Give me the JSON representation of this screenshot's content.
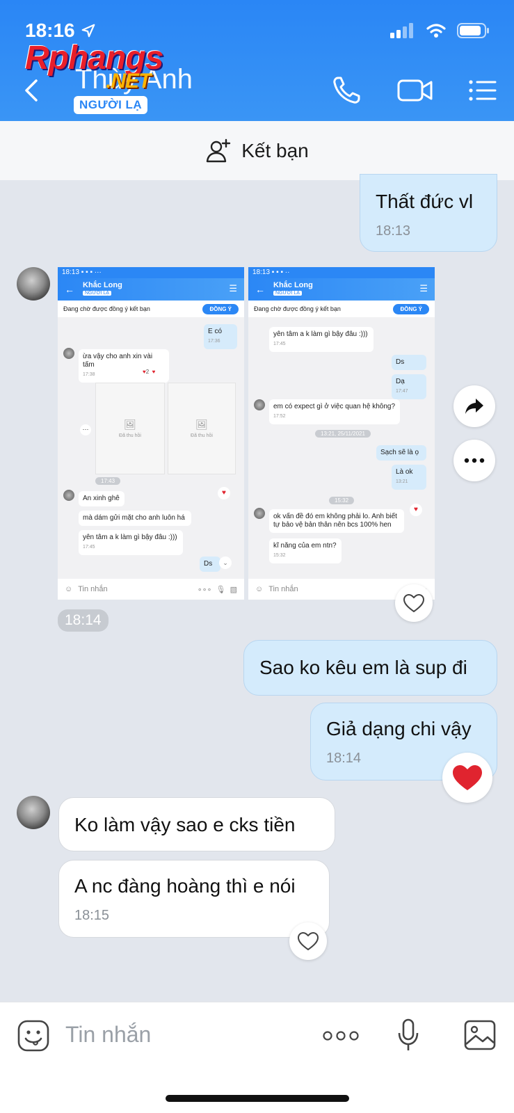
{
  "status": {
    "time": "18:16"
  },
  "watermark": {
    "brand": "Rphangs",
    "suffix": ".NET"
  },
  "header": {
    "contact_name": "Thùy Anh",
    "badge": "NGƯỜI LẠ"
  },
  "friend_bar": {
    "label": "Kết bạn"
  },
  "messages": {
    "m1": {
      "text": "Thất đức vl",
      "time": "18:13"
    },
    "img_time": "18:14",
    "m2": {
      "text": "Sao ko kêu em là sup đi"
    },
    "m3": {
      "text": "Giả dạng chi vậy",
      "time": "18:14"
    },
    "m4": {
      "text": "Ko làm vậy sao e  cks tiền"
    },
    "m5": {
      "text": "A nc đàng hoàng thì e nói",
      "time": "18:15"
    }
  },
  "shot_left": {
    "time": "18:13",
    "name": "Khắc Long",
    "badge": "NGƯỜI LẠ",
    "pending": "Đang chờ được đồng ý kết bạn",
    "accept": "ĐỒNG Ý",
    "msgs": [
      {
        "text": "E có",
        "time": "17:36"
      },
      {
        "text": "ừa vậy cho anh xin vài tấm",
        "time": "17:38"
      },
      {
        "text": "Đã thu hồi"
      },
      {
        "text": "Đã thu hồi"
      },
      {
        "text": "17:43"
      },
      {
        "text": "An xinh ghê"
      },
      {
        "text": "mà dám gửi mặt cho anh luôn há"
      },
      {
        "text": "yên tâm a k làm gì bậy đâu :)))",
        "time": "17:45"
      },
      {
        "text": "Ds"
      }
    ],
    "react_count": "2",
    "input": "Tin nhắn"
  },
  "shot_right": {
    "time": "18:13",
    "name": "Khắc Long",
    "badge": "NGƯỜI LẠ",
    "pending": "Đang chờ được đồng ý kết bạn",
    "accept": "ĐỒNG Ý",
    "msgs": [
      {
        "text": "yên tâm a k làm gì bậy đâu :)))",
        "time": "17:45"
      },
      {
        "text": "Ds"
      },
      {
        "text": "Dạ",
        "time": "17:47"
      },
      {
        "text": "em có expect gì ở việc quan hệ không?",
        "time": "17:52"
      },
      {
        "text": "13:21, 25/11/2021"
      },
      {
        "text": "Sạch sẽ là ọ"
      },
      {
        "text": "Là ok",
        "time": "13:21"
      },
      {
        "text": "15:32"
      },
      {
        "text": "ok vấn đề đó em không phải lo. Anh biết tự bảo vệ bản thân nên bcs 100% hen"
      },
      {
        "text": "kĩ năng của em ntn?",
        "time": "15:32"
      }
    ],
    "input": "Tin nhắn"
  },
  "composer": {
    "placeholder": "Tin nhắn"
  },
  "colors": {
    "header": "#2a86f5",
    "my_bubble": "#d4ebfc",
    "heart": "#e0242f"
  }
}
